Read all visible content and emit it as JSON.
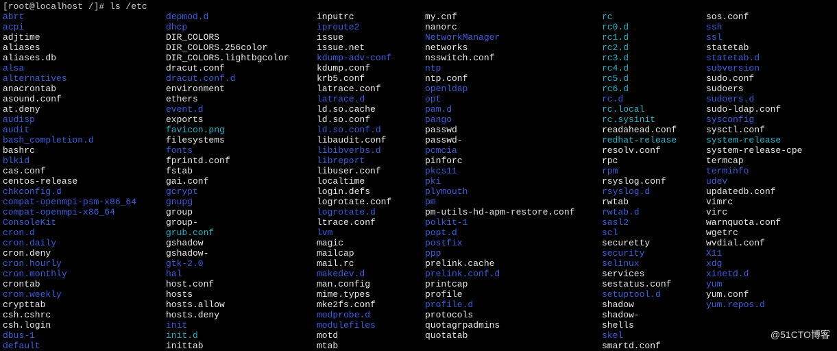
{
  "prompt": "[root@localhost /]# ls /etc",
  "watermark": "@51CTO博客",
  "colors": {
    "dir": "#3b5ed7",
    "link": "#2bb1c7",
    "file": "#e8e8e8",
    "special": "#9b2e2e"
  },
  "columns": [
    [
      {
        "n": "abrt",
        "c": "blue"
      },
      {
        "n": "acpi",
        "c": "blue"
      },
      {
        "n": "adjtime",
        "c": "white"
      },
      {
        "n": "aliases",
        "c": "white"
      },
      {
        "n": "aliases.db",
        "c": "white"
      },
      {
        "n": "alsa",
        "c": "blue"
      },
      {
        "n": "alternatives",
        "c": "blue"
      },
      {
        "n": "anacrontab",
        "c": "white"
      },
      {
        "n": "asound.conf",
        "c": "white"
      },
      {
        "n": "at.deny",
        "c": "white"
      },
      {
        "n": "audisp",
        "c": "blue"
      },
      {
        "n": "audit",
        "c": "blue"
      },
      {
        "n": "bash_completion.d",
        "c": "blue"
      },
      {
        "n": "bashrc",
        "c": "white"
      },
      {
        "n": "blkid",
        "c": "blue"
      },
      {
        "n": "cas.conf",
        "c": "white"
      },
      {
        "n": "centos-release",
        "c": "white"
      },
      {
        "n": "chkconfig.d",
        "c": "blue"
      },
      {
        "n": "compat-openmpi-psm-x86_64",
        "c": "blue"
      },
      {
        "n": "compat-openmpi-x86_64",
        "c": "blue"
      },
      {
        "n": "ConsoleKit",
        "c": "blue"
      },
      {
        "n": "cron.d",
        "c": "blue"
      },
      {
        "n": "cron.daily",
        "c": "blue"
      },
      {
        "n": "cron.deny",
        "c": "white"
      },
      {
        "n": "cron.hourly",
        "c": "blue"
      },
      {
        "n": "cron.monthly",
        "c": "blue"
      },
      {
        "n": "crontab",
        "c": "white"
      },
      {
        "n": "cron.weekly",
        "c": "blue"
      },
      {
        "n": "crypttab",
        "c": "white"
      },
      {
        "n": "csh.cshrc",
        "c": "white"
      },
      {
        "n": "csh.login",
        "c": "white"
      },
      {
        "n": "dbus-1",
        "c": "blue"
      },
      {
        "n": "default",
        "c": "blue"
      }
    ],
    [
      {
        "n": "depmod.d",
        "c": "blue"
      },
      {
        "n": "dhcp",
        "c": "blue"
      },
      {
        "n": "DIR_COLORS",
        "c": "white"
      },
      {
        "n": "DIR_COLORS.256color",
        "c": "white"
      },
      {
        "n": "DIR_COLORS.lightbgcolor",
        "c": "white"
      },
      {
        "n": "dracut.conf",
        "c": "white"
      },
      {
        "n": "dracut.conf.d",
        "c": "blue"
      },
      {
        "n": "environment",
        "c": "white"
      },
      {
        "n": "ethers",
        "c": "white"
      },
      {
        "n": "event.d",
        "c": "blue"
      },
      {
        "n": "exports",
        "c": "white"
      },
      {
        "n": "favicon.png",
        "c": "cyan"
      },
      {
        "n": "filesystems",
        "c": "white"
      },
      {
        "n": "fonts",
        "c": "blue"
      },
      {
        "n": "fprintd.conf",
        "c": "white"
      },
      {
        "n": "fstab",
        "c": "white"
      },
      {
        "n": "gai.conf",
        "c": "white"
      },
      {
        "n": "gcrypt",
        "c": "blue"
      },
      {
        "n": "gnupg",
        "c": "blue"
      },
      {
        "n": "group",
        "c": "white"
      },
      {
        "n": "group-",
        "c": "white"
      },
      {
        "n": "grub.conf",
        "c": "cyan"
      },
      {
        "n": "gshadow",
        "c": "white"
      },
      {
        "n": "gshadow-",
        "c": "white"
      },
      {
        "n": "gtk-2.0",
        "c": "blue"
      },
      {
        "n": "hal",
        "c": "blue"
      },
      {
        "n": "host.conf",
        "c": "white"
      },
      {
        "n": "hosts",
        "c": "white"
      },
      {
        "n": "hosts.allow",
        "c": "white"
      },
      {
        "n": "hosts.deny",
        "c": "white"
      },
      {
        "n": "init",
        "c": "blue"
      },
      {
        "n": "init.d",
        "c": "cyan"
      },
      {
        "n": "inittab",
        "c": "white"
      }
    ],
    [
      {
        "n": "inputrc",
        "c": "white"
      },
      {
        "n": "iproute2",
        "c": "blue"
      },
      {
        "n": "issue",
        "c": "white"
      },
      {
        "n": "issue.net",
        "c": "white"
      },
      {
        "n": "kdump-adv-conf",
        "c": "blue"
      },
      {
        "n": "kdump.conf",
        "c": "white"
      },
      {
        "n": "krb5.conf",
        "c": "white"
      },
      {
        "n": "latrace.conf",
        "c": "white"
      },
      {
        "n": "latrace.d",
        "c": "blue"
      },
      {
        "n": "ld.so.cache",
        "c": "white"
      },
      {
        "n": "ld.so.conf",
        "c": "white"
      },
      {
        "n": "ld.so.conf.d",
        "c": "blue"
      },
      {
        "n": "libaudit.conf",
        "c": "white"
      },
      {
        "n": "libibverbs.d",
        "c": "blue"
      },
      {
        "n": "libreport",
        "c": "blue"
      },
      {
        "n": "libuser.conf",
        "c": "white"
      },
      {
        "n": "localtime",
        "c": "white"
      },
      {
        "n": "login.defs",
        "c": "white"
      },
      {
        "n": "logrotate.conf",
        "c": "white"
      },
      {
        "n": "logrotate.d",
        "c": "blue"
      },
      {
        "n": "ltrace.conf",
        "c": "white"
      },
      {
        "n": "lvm",
        "c": "blue"
      },
      {
        "n": "magic",
        "c": "white"
      },
      {
        "n": "mailcap",
        "c": "white"
      },
      {
        "n": "mail.rc",
        "c": "white"
      },
      {
        "n": "makedev.d",
        "c": "blue"
      },
      {
        "n": "man.config",
        "c": "white"
      },
      {
        "n": "mime.types",
        "c": "white"
      },
      {
        "n": "mke2fs.conf",
        "c": "white"
      },
      {
        "n": "modprobe.d",
        "c": "blue"
      },
      {
        "n": "modulefiles",
        "c": "blue"
      },
      {
        "n": "motd",
        "c": "white"
      },
      {
        "n": "mtab",
        "c": "white"
      }
    ],
    [
      {
        "n": "my.cnf",
        "c": "white"
      },
      {
        "n": "nanorc",
        "c": "white"
      },
      {
        "n": "NetworkManager",
        "c": "blue"
      },
      {
        "n": "networks",
        "c": "white"
      },
      {
        "n": "nsswitch.conf",
        "c": "white"
      },
      {
        "n": "ntp",
        "c": "blue"
      },
      {
        "n": "ntp.conf",
        "c": "white"
      },
      {
        "n": "openldap",
        "c": "blue"
      },
      {
        "n": "opt",
        "c": "blue"
      },
      {
        "n": "pam.d",
        "c": "blue"
      },
      {
        "n": "pango",
        "c": "blue"
      },
      {
        "n": "passwd",
        "c": "white"
      },
      {
        "n": "passwd-",
        "c": "white"
      },
      {
        "n": "pcmcia",
        "c": "blue"
      },
      {
        "n": "pinforc",
        "c": "white"
      },
      {
        "n": "pkcs11",
        "c": "blue"
      },
      {
        "n": "pki",
        "c": "blue"
      },
      {
        "n": "plymouth",
        "c": "blue"
      },
      {
        "n": "pm",
        "c": "blue"
      },
      {
        "n": "pm-utils-hd-apm-restore.conf",
        "c": "white"
      },
      {
        "n": "polkit-1",
        "c": "blue"
      },
      {
        "n": "popt.d",
        "c": "blue"
      },
      {
        "n": "postfix",
        "c": "blue"
      },
      {
        "n": "ppp",
        "c": "blue"
      },
      {
        "n": "prelink.cache",
        "c": "white"
      },
      {
        "n": "prelink.conf.d",
        "c": "blue"
      },
      {
        "n": "printcap",
        "c": "white"
      },
      {
        "n": "profile",
        "c": "white"
      },
      {
        "n": "profile.d",
        "c": "blue"
      },
      {
        "n": "protocols",
        "c": "white"
      },
      {
        "n": "quotagrpadmins",
        "c": "white"
      },
      {
        "n": "quotatab",
        "c": "white"
      }
    ],
    [
      {
        "n": "rc",
        "c": "cyan"
      },
      {
        "n": "rc0.d",
        "c": "cyan"
      },
      {
        "n": "rc1.d",
        "c": "cyan"
      },
      {
        "n": "rc2.d",
        "c": "cyan"
      },
      {
        "n": "rc3.d",
        "c": "cyan"
      },
      {
        "n": "rc4.d",
        "c": "cyan"
      },
      {
        "n": "rc5.d",
        "c": "cyan"
      },
      {
        "n": "rc6.d",
        "c": "cyan"
      },
      {
        "n": "rc.d",
        "c": "blue"
      },
      {
        "n": "rc.local",
        "c": "cyan"
      },
      {
        "n": "rc.sysinit",
        "c": "cyan"
      },
      {
        "n": "readahead.conf",
        "c": "white"
      },
      {
        "n": "redhat-release",
        "c": "cyan"
      },
      {
        "n": "resolv.conf",
        "c": "white"
      },
      {
        "n": "rpc",
        "c": "white"
      },
      {
        "n": "rpm",
        "c": "blue"
      },
      {
        "n": "rsyslog.conf",
        "c": "white"
      },
      {
        "n": "rsyslog.d",
        "c": "blue"
      },
      {
        "n": "rwtab",
        "c": "white"
      },
      {
        "n": "rwtab.d",
        "c": "blue"
      },
      {
        "n": "sasl2",
        "c": "blue"
      },
      {
        "n": "scl",
        "c": "blue"
      },
      {
        "n": "securetty",
        "c": "white"
      },
      {
        "n": "security",
        "c": "blue"
      },
      {
        "n": "selinux",
        "c": "blue"
      },
      {
        "n": "services",
        "c": "white"
      },
      {
        "n": "sestatus.conf",
        "c": "white"
      },
      {
        "n": "setuptool.d",
        "c": "blue"
      },
      {
        "n": "shadow",
        "c": "white"
      },
      {
        "n": "shadow-",
        "c": "white"
      },
      {
        "n": "shells",
        "c": "white"
      },
      {
        "n": "skel",
        "c": "blue"
      },
      {
        "n": "smartd.conf",
        "c": "white"
      }
    ],
    [
      {
        "n": "sos.conf",
        "c": "white"
      },
      {
        "n": "ssh",
        "c": "blue"
      },
      {
        "n": "ssl",
        "c": "blue"
      },
      {
        "n": "statetab",
        "c": "white"
      },
      {
        "n": "statetab.d",
        "c": "blue"
      },
      {
        "n": "subversion",
        "c": "blue"
      },
      {
        "n": "sudo.conf",
        "c": "white"
      },
      {
        "n": "sudoers",
        "c": "white"
      },
      {
        "n": "sudoers.d",
        "c": "blue"
      },
      {
        "n": "sudo-ldap.conf",
        "c": "white"
      },
      {
        "n": "sysconfig",
        "c": "blue"
      },
      {
        "n": "sysctl.conf",
        "c": "white"
      },
      {
        "n": "system-release",
        "c": "cyan"
      },
      {
        "n": "system-release-cpe",
        "c": "white"
      },
      {
        "n": "termcap",
        "c": "white"
      },
      {
        "n": "terminfo",
        "c": "blue"
      },
      {
        "n": "udev",
        "c": "blue"
      },
      {
        "n": "updatedb.conf",
        "c": "white"
      },
      {
        "n": "vimrc",
        "c": "white"
      },
      {
        "n": "virc",
        "c": "white"
      },
      {
        "n": "warnquota.conf",
        "c": "white"
      },
      {
        "n": "wgetrc",
        "c": "white"
      },
      {
        "n": "wvdial.conf",
        "c": "white"
      },
      {
        "n": "X11",
        "c": "blue"
      },
      {
        "n": "xdg",
        "c": "blue"
      },
      {
        "n": "xinetd.d",
        "c": "blue"
      },
      {
        "n": "yum",
        "c": "blue"
      },
      {
        "n": "yum.conf",
        "c": "white"
      },
      {
        "n": "yum.repos.d",
        "c": "blue"
      }
    ]
  ]
}
